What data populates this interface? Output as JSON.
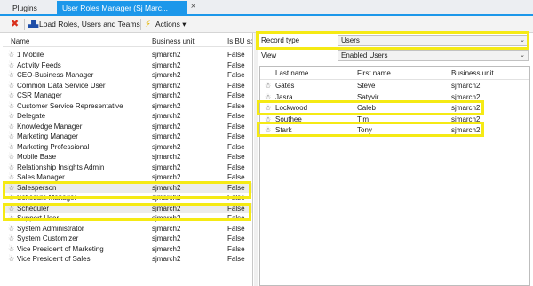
{
  "tabs": [
    {
      "label": "Plugins",
      "active": false
    },
    {
      "label": "User Roles Manager (Sj Marc...",
      "active": true
    }
  ],
  "tab_close_glyph": "×",
  "toolbar": {
    "load_label": "Load Roles, Users and Teams",
    "actions_label": "Actions",
    "actions_caret": "▾"
  },
  "icons": {
    "delete": "delete-icon",
    "load": "load-roles-icon",
    "actions": "lightning-icon",
    "user": "user-icon"
  },
  "roles_table": {
    "columns": [
      "Name",
      "Business unit",
      "Is BU sp..."
    ],
    "rows": [
      {
        "name": "1 Mobile",
        "bu": "sjmarch2",
        "is_bu": "False"
      },
      {
        "name": "Activity Feeds",
        "bu": "sjmarch2",
        "is_bu": "False"
      },
      {
        "name": "CEO-Business Manager",
        "bu": "sjmarch2",
        "is_bu": "False"
      },
      {
        "name": "Common Data Service User",
        "bu": "sjmarch2",
        "is_bu": "False"
      },
      {
        "name": "CSR Manager",
        "bu": "sjmarch2",
        "is_bu": "False"
      },
      {
        "name": "Customer Service Representative",
        "bu": "sjmarch2",
        "is_bu": "False"
      },
      {
        "name": "Delegate",
        "bu": "sjmarch2",
        "is_bu": "False"
      },
      {
        "name": "Knowledge Manager",
        "bu": "sjmarch2",
        "is_bu": "False"
      },
      {
        "name": "Marketing Manager",
        "bu": "sjmarch2",
        "is_bu": "False"
      },
      {
        "name": "Marketing Professional",
        "bu": "sjmarch2",
        "is_bu": "False"
      },
      {
        "name": "Mobile Base",
        "bu": "sjmarch2",
        "is_bu": "False"
      },
      {
        "name": "Relationship Insights Admin",
        "bu": "sjmarch2",
        "is_bu": "False"
      },
      {
        "name": "Sales Manager",
        "bu": "sjmarch2",
        "is_bu": "False"
      },
      {
        "name": "Salesperson",
        "bu": "sjmarch2",
        "is_bu": "False",
        "highlight": true
      },
      {
        "name": "Schedule Manager",
        "bu": "sjmarch2",
        "is_bu": "False"
      },
      {
        "name": "Scheduler",
        "bu": "sjmarch2",
        "is_bu": "False",
        "highlight": true
      },
      {
        "name": "Support User",
        "bu": "sjmarch2",
        "is_bu": "False"
      },
      {
        "name": "System Administrator",
        "bu": "sjmarch2",
        "is_bu": "False"
      },
      {
        "name": "System Customizer",
        "bu": "sjmarch2",
        "is_bu": "False"
      },
      {
        "name": "Vice President of Marketing",
        "bu": "sjmarch2",
        "is_bu": "False"
      },
      {
        "name": "Vice President of Sales",
        "bu": "sjmarch2",
        "is_bu": "False"
      }
    ]
  },
  "record_type": {
    "label": "Record type",
    "value": "Users",
    "chevron": "⌄"
  },
  "view": {
    "label": "View",
    "value": "Enabled Users",
    "chevron": "⌄"
  },
  "users_table": {
    "columns": [
      "Last name",
      "First name",
      "Business unit"
    ],
    "rows": [
      {
        "last": "Gates",
        "first": "Steve",
        "bu": "sjmarch2"
      },
      {
        "last": "Jasra",
        "first": "Satyvir",
        "bu": "sjmarch2"
      },
      {
        "last": "Lockwood",
        "first": "Caleb",
        "bu": "sjmarch2",
        "highlight": true
      },
      {
        "last": "Southee",
        "first": "Tim",
        "bu": "sjmarch2"
      },
      {
        "last": "Stark",
        "first": "Tony",
        "bu": "sjmarch2",
        "highlight": true
      }
    ]
  },
  "colors": {
    "accent_tab": "#1c97ea",
    "highlight_box": "#f5ea14",
    "delete_icon": "#d9301c"
  }
}
